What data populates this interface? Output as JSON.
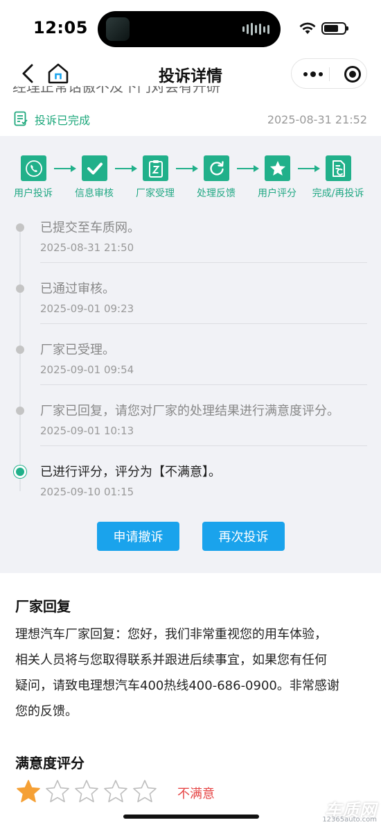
{
  "status_bar": {
    "time": "12:05"
  },
  "nav": {
    "title": "投诉详情"
  },
  "truncated_line": "经理正常话傲不及下门对会有开研",
  "complaint": {
    "status_label": "投诉已完成",
    "time": "2025-08-31 21:52"
  },
  "steps": [
    {
      "label": "用户投诉",
      "icon": "phone-icon"
    },
    {
      "label": "信息审核",
      "icon": "check-icon"
    },
    {
      "label": "厂家受理",
      "icon": "clipboard-icon"
    },
    {
      "label": "处理反馈",
      "icon": "refresh-icon"
    },
    {
      "label": "用户评分",
      "icon": "star-icon"
    },
    {
      "label": "完成/再投诉",
      "icon": "document-icon"
    }
  ],
  "timeline": [
    {
      "text": "已提交至车质网。",
      "time": "2025-08-31 21:50"
    },
    {
      "text": "已通过审核。",
      "time": "2025-09-01 09:23"
    },
    {
      "text": "厂家已受理。",
      "time": "2025-09-01 09:54"
    },
    {
      "text": "厂家已回复，请您对厂家的处理结果进行满意度评分。",
      "time": "2025-09-01 10:13"
    },
    {
      "text": "已进行评分，评分为【不满意】。",
      "time": "2025-09-10 01:15"
    }
  ],
  "buttons": {
    "withdraw": "申请撤诉",
    "recomplain": "再次投诉"
  },
  "reply": {
    "title": "厂家回复",
    "lines": [
      "理想汽车厂家回复：您好，我们非常重视您的用车体验，",
      "相关人员将与您取得联系并跟进后续事宜，如果您有任何",
      "疑问，请致电理想汽车400热线400-686-0900。非常感谢",
      "您的反馈。"
    ]
  },
  "rating": {
    "title": "满意度评分",
    "stars_filled": 1,
    "stars_total": 5,
    "label": "不满意"
  },
  "watermark": {
    "main": "车质网",
    "sub": "12365auto.com"
  },
  "colors": {
    "accent_green": "#21b08a",
    "button_blue": "#1aa3ec",
    "rating_red": "#e64545",
    "star_orange": "#f5a035"
  }
}
